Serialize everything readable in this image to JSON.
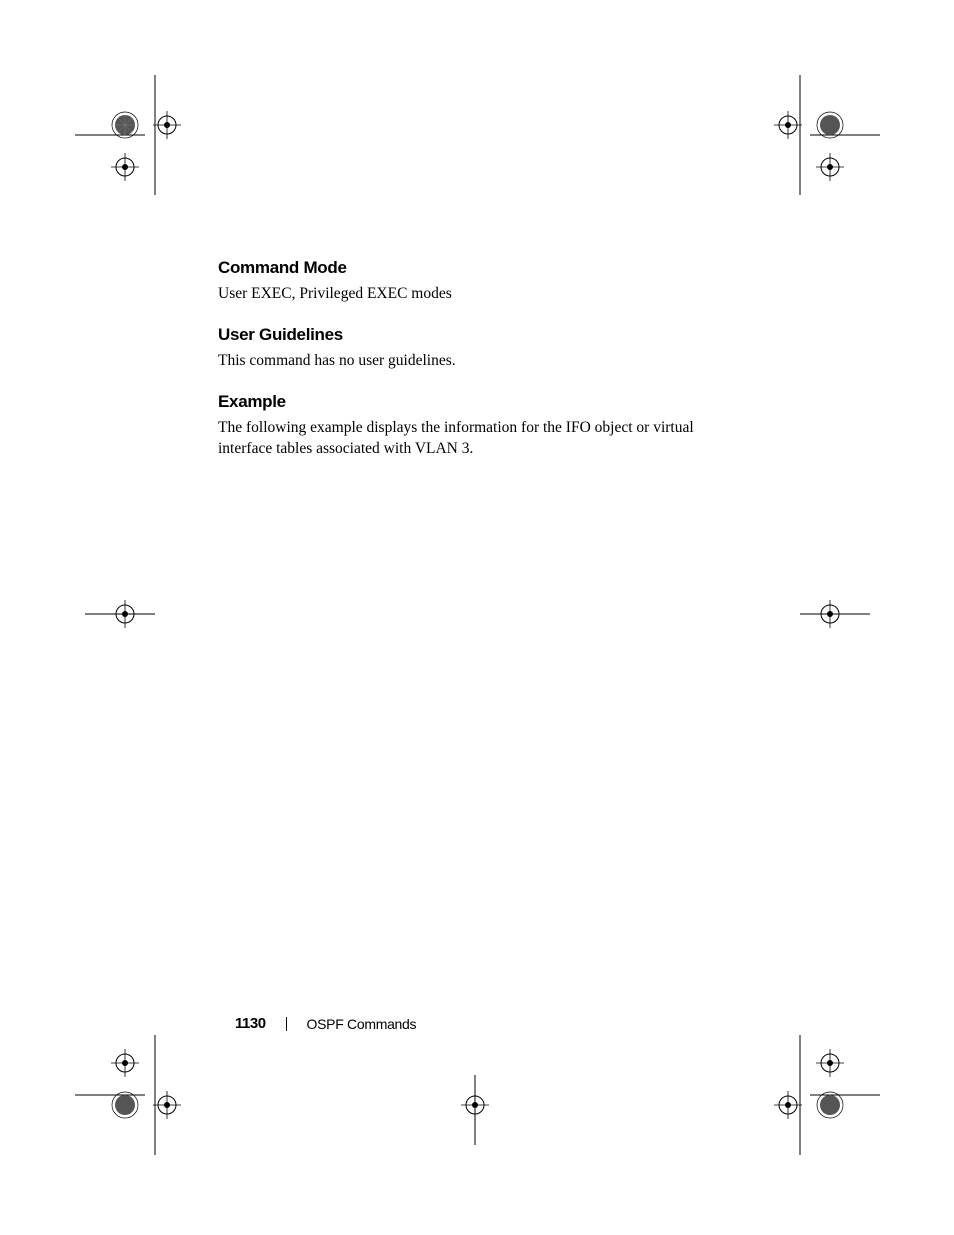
{
  "sections": {
    "commandMode": {
      "heading": "Command Mode",
      "text": "User EXEC, Privileged EXEC modes"
    },
    "userGuidelines": {
      "heading": "User Guidelines",
      "text": "This command has no user guidelines."
    },
    "example": {
      "heading": "Example",
      "text": "The following example displays the information for the IFO object or virtual interface tables associated with VLAN 3."
    }
  },
  "footer": {
    "pageNumber": "1130",
    "label": "OSPF Commands"
  }
}
